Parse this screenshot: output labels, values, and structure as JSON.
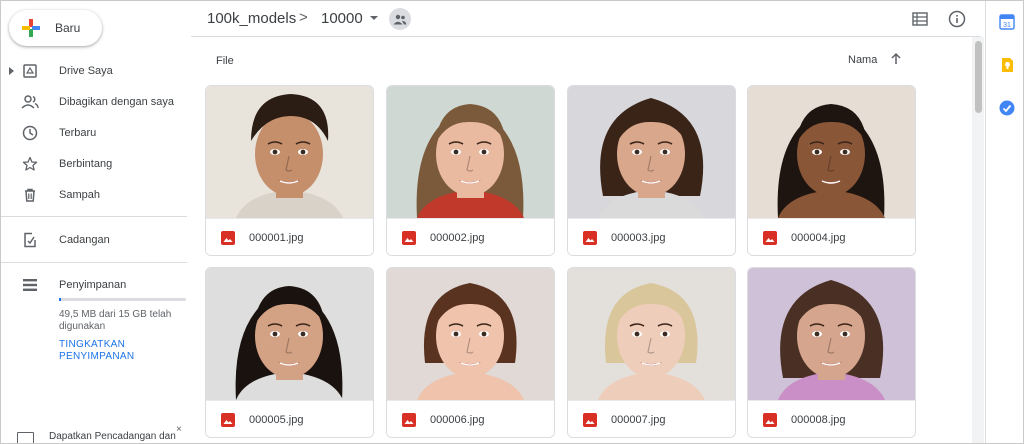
{
  "new_button": {
    "label": "Baru"
  },
  "sidebar": {
    "items": [
      {
        "label": "Drive Saya",
        "icon": "my-drive-icon"
      },
      {
        "label": "Dibagikan dengan saya",
        "icon": "shared-people-icon"
      },
      {
        "label": "Terbaru",
        "icon": "clock-icon"
      },
      {
        "label": "Berbintang",
        "icon": "star-icon"
      },
      {
        "label": "Sampah",
        "icon": "trash-icon"
      },
      {
        "label": "Cadangan",
        "icon": "backup-icon"
      },
      {
        "label": "Penyimpanan",
        "icon": "storage-icon"
      }
    ],
    "storage_text": "49,5 MB dari 15 GB telah digunakan",
    "storage_used_fraction": 0.0033,
    "upgrade_label": "TINGKATKAN PENYIMPANAN",
    "promo_text": "Dapatkan Pencadangan dan",
    "promo_close": "×"
  },
  "breadcrumb": {
    "root": "100k_models",
    "separator": ">",
    "current": "10000"
  },
  "content": {
    "section_title": "File",
    "sort_label": "Nama",
    "files": [
      {
        "name": "000001.jpg"
      },
      {
        "name": "000002.jpg"
      },
      {
        "name": "000003.jpg"
      },
      {
        "name": "000004.jpg"
      },
      {
        "name": "000005.jpg"
      },
      {
        "name": "000006.jpg"
      },
      {
        "name": "000007.jpg"
      },
      {
        "name": "000008.jpg"
      }
    ]
  },
  "colors": {
    "accent": "#1a73e8",
    "image_file": "#d93025",
    "border": "#dadce0",
    "text": "#3c4043"
  }
}
